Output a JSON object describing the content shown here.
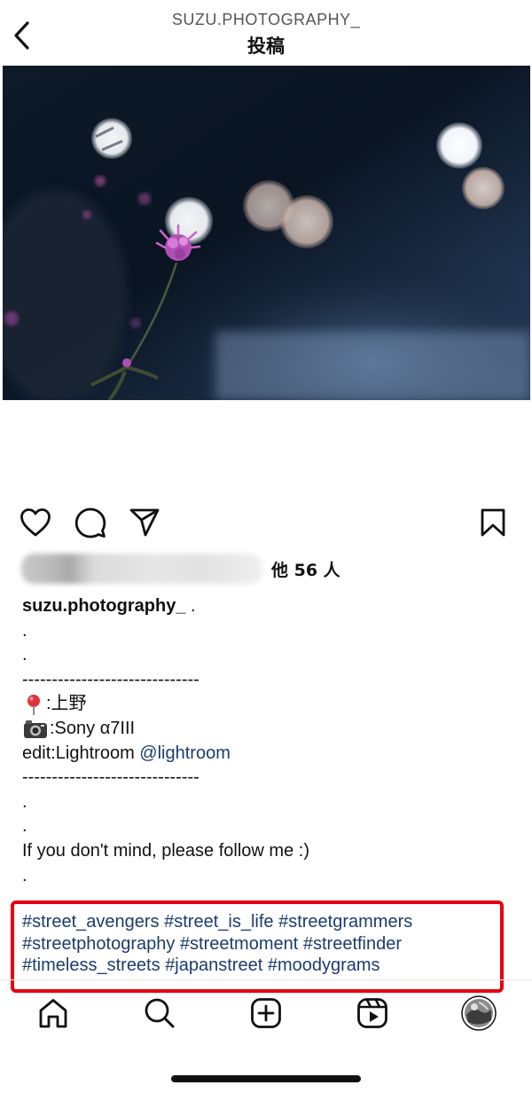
{
  "header": {
    "username": "SUZU.PHOTOGRAPHY_",
    "title": "投稿"
  },
  "icons": {
    "back": "chevron-left-icon",
    "like": "heart-icon",
    "comment": "comment-bubble-icon",
    "share": "paper-plane-icon",
    "save": "bookmark-icon"
  },
  "likes": {
    "count_text": "他 56 人"
  },
  "caption": {
    "username": "suzu.photography_",
    "username_suffix": " .",
    "dot": ".",
    "separator": "------------------------------",
    "location_label": ":上野",
    "camera_label": ":Sony α7III",
    "edit_prefix": "edit:Lightroom ",
    "mention": "@lightroom",
    "follow_text": "If you don't mind, please follow me :)"
  },
  "hashtags": {
    "row1": [
      "#street_avengers",
      "#street_is_life",
      "#streetgrammers"
    ],
    "row2": [
      "#streetphotography",
      "#streetmoment",
      "#streetfinder"
    ],
    "row3": [
      "#timeless_streets",
      "#japanstreet",
      "#moodygrams"
    ]
  },
  "colors": {
    "link": "#1b3c6f",
    "highlight_box": "#e60012",
    "text": "#111111"
  },
  "tabbar": [
    "home-icon",
    "search-icon",
    "create-post-icon",
    "reels-icon",
    "profile-avatar"
  ]
}
